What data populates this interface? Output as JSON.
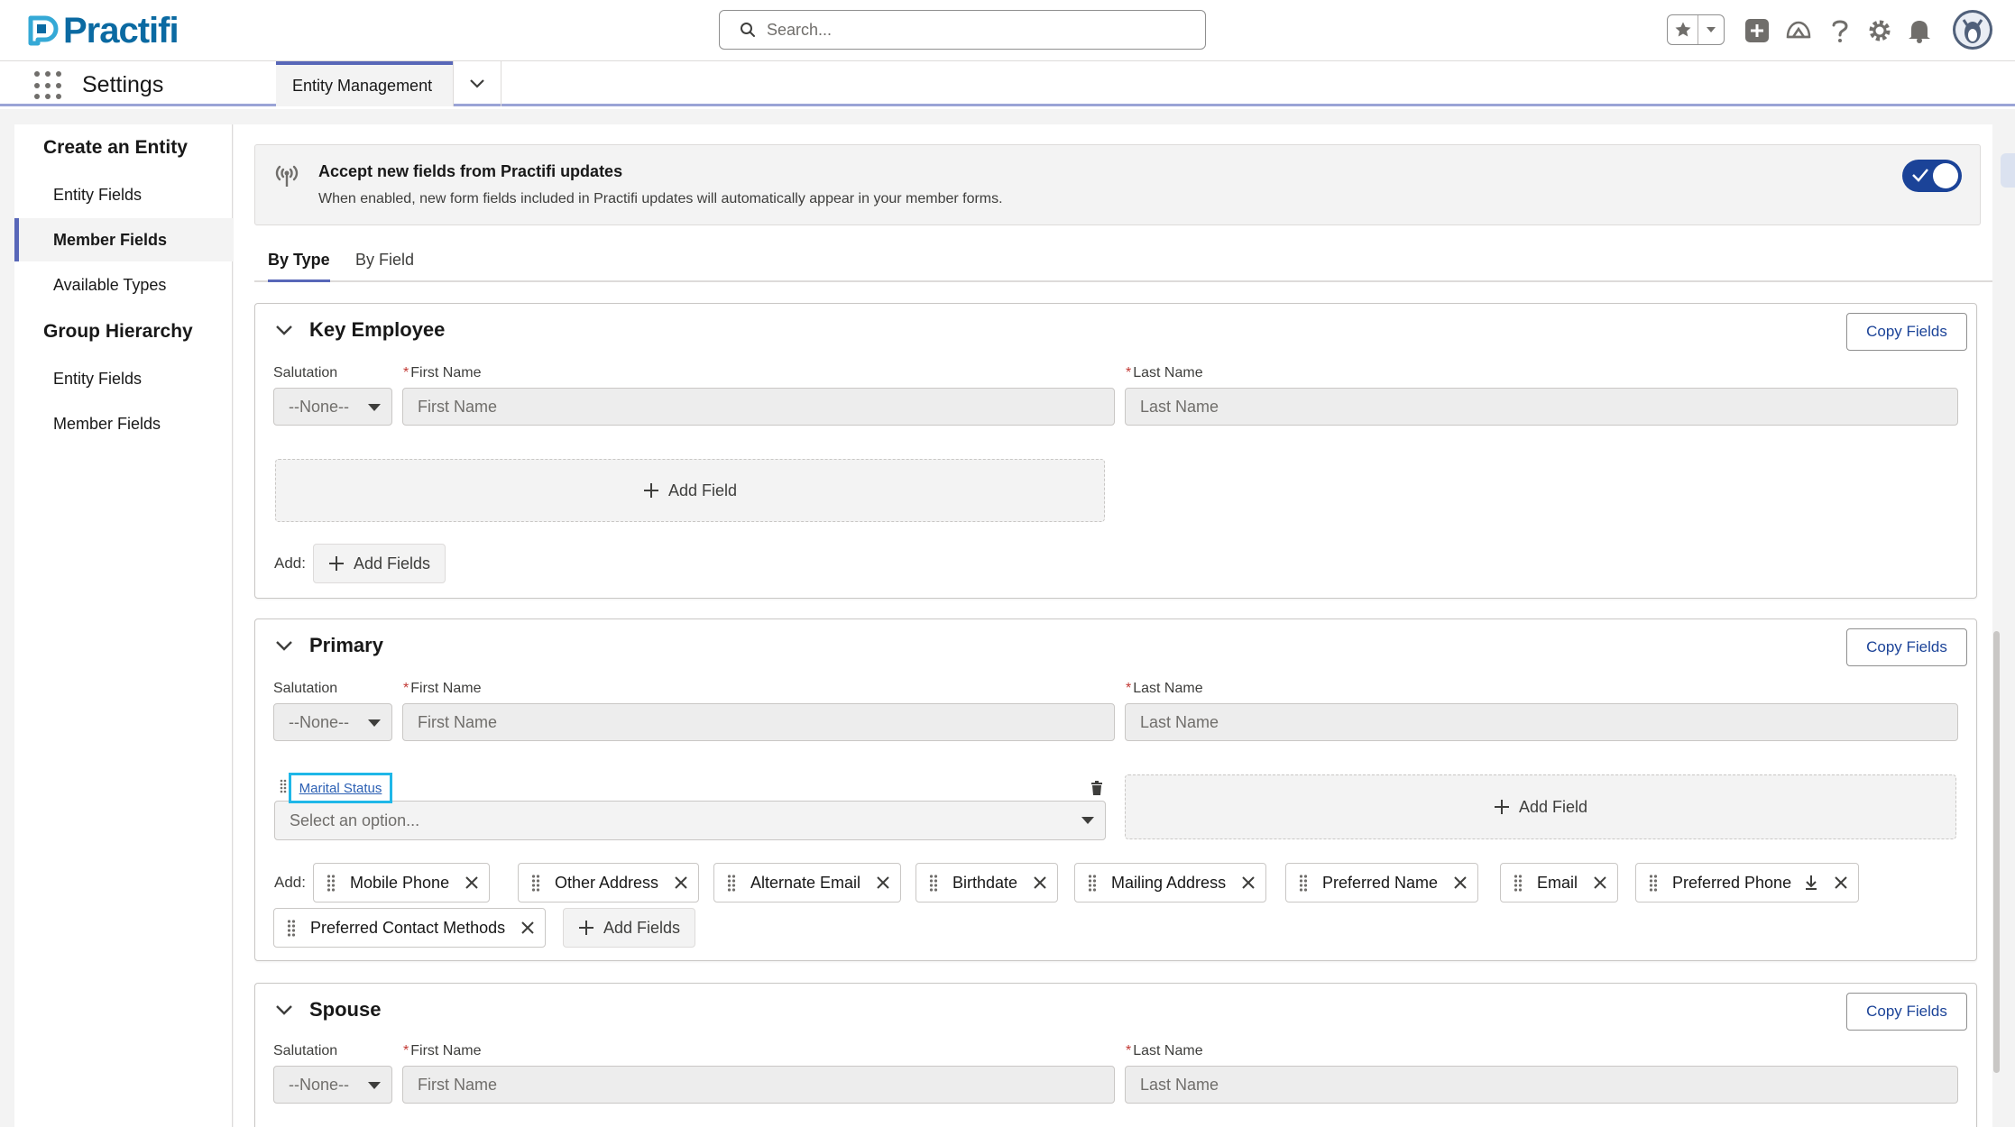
{
  "header": {
    "logo_text": "Practifi",
    "search_placeholder": "Search..."
  },
  "nav": {
    "app_name": "Settings",
    "active_tab": "Entity Management"
  },
  "sidebar": {
    "sections": [
      {
        "title": "Create an Entity",
        "items": [
          "Entity Fields",
          "Member Fields",
          "Available Types"
        ],
        "active_index": 1
      },
      {
        "title": "Group Hierarchy",
        "items": [
          "Entity Fields",
          "Member Fields"
        ]
      }
    ]
  },
  "banner": {
    "title": "Accept new fields from Practifi updates",
    "description": "When enabled, new form fields included in Practifi updates will automatically appear in your member forms.",
    "toggle_on": true
  },
  "tabs": [
    "By Type",
    "By Field"
  ],
  "active_tab_index": 0,
  "common": {
    "copy_fields": "Copy Fields",
    "salutation_label": "Salutation",
    "salutation_value": "--None--",
    "first_name_label": "First Name",
    "first_name_placeholder": "First Name",
    "last_name_label": "Last Name",
    "last_name_placeholder": "Last Name",
    "add_field": "Add Field",
    "add_label": "Add:",
    "add_fields": "Add Fields"
  },
  "sections": [
    {
      "title": "Key Employee"
    },
    {
      "title": "Primary",
      "extra_field_label": "Marital Status",
      "extra_field_placeholder": "Select an option...",
      "chips": [
        {
          "label": "Mobile Phone"
        },
        {
          "label": "Other Address"
        },
        {
          "label": "Alternate Email"
        },
        {
          "label": "Birthdate"
        },
        {
          "label": "Mailing Address"
        },
        {
          "label": "Preferred Name"
        },
        {
          "label": "Email"
        },
        {
          "label": "Preferred Phone",
          "download_icon": true
        },
        {
          "label": "Preferred Contact Methods"
        }
      ]
    },
    {
      "title": "Spouse"
    }
  ],
  "colors": {
    "brand": "#0b6aa2",
    "accent": "#5867b8",
    "toggle": "#1b4398",
    "highlight": "#1fb7e8"
  }
}
